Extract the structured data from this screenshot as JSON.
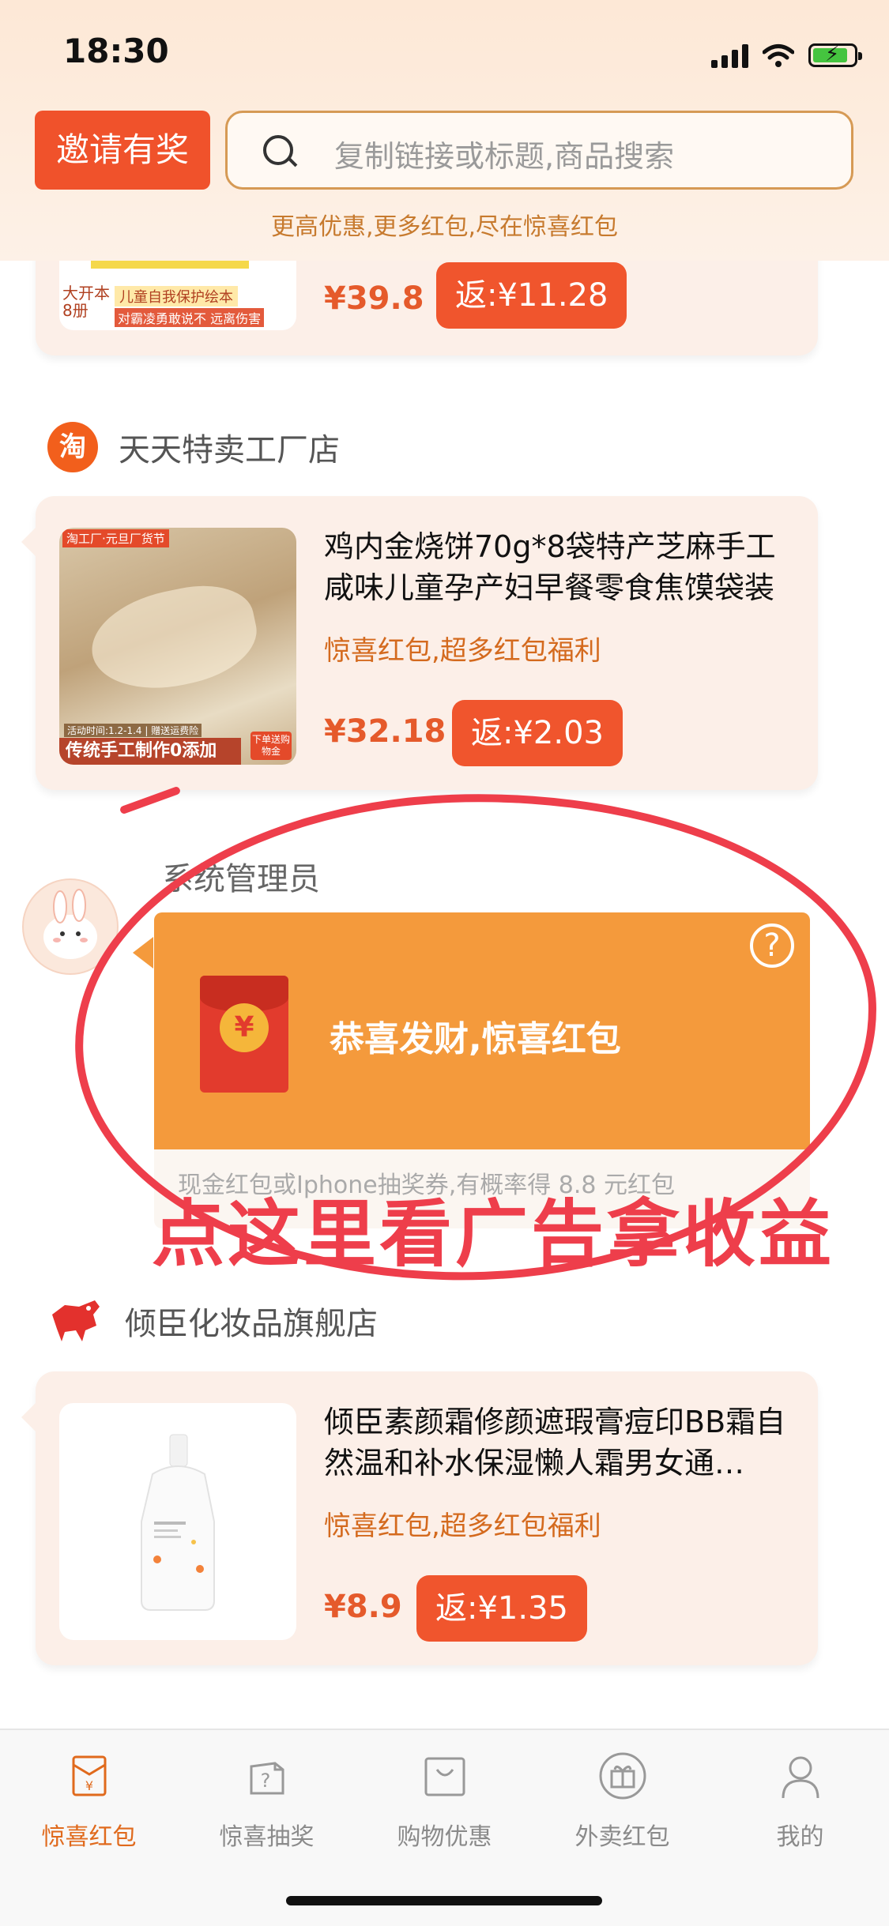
{
  "status_bar": {
    "time": "18:30"
  },
  "header": {
    "invite_label": "邀请有奖",
    "search_placeholder": "复制链接或标题,商品搜索",
    "slogan": "更高优惠,更多红包,尽在惊喜红包"
  },
  "cards": {
    "partial": {
      "price": "¥39.8",
      "rebate": "返:¥11.28",
      "image_text_1": "大开本8册",
      "image_text_2": "儿童自我保护绘本",
      "image_text_3": "对霸凌勇敢说不 远离伤害"
    },
    "item1": {
      "shop_name": "天天特卖工厂店",
      "shop_icon_text": "淘",
      "title": "鸡内金烧饼70g*8袋特产芝麻手工咸味儿童孕产妇早餐零食焦馍袋装",
      "subtitle": "惊喜红包,超多红包福利",
      "price": "¥32.18",
      "rebate": "返:¥2.03",
      "image_top_text": "淘工厂·元旦厂货节",
      "image_bottom_text": "传统手工制作0添加",
      "image_small_text": "活动时间:1.2-1.4 | 赠送运费险",
      "image_badge_text": "下单送购物金"
    },
    "admin": {
      "name": "系统管理员",
      "redpacket_title": "恭喜发财,惊喜红包",
      "redpacket_desc": "现金红包或Iphone抽奖券,有概率得 8.8 元红包",
      "coin_symbol": "¥",
      "help_symbol": "?"
    },
    "annotation": {
      "text": "点这里看广告拿收益"
    },
    "item2": {
      "shop_name": "倾臣化妆品旗舰店",
      "title": "倾臣素颜霜修颜遮瑕膏痘印BB霜自然温和补水保湿懒人霜男女通…",
      "subtitle": "惊喜红包,超多红包福利",
      "price": "¥8.9",
      "rebate": "返:¥1.35"
    }
  },
  "tabbar": {
    "tabs": [
      {
        "label": "惊喜红包",
        "icon": "red-packet-icon",
        "active": true
      },
      {
        "label": "惊喜抽奖",
        "icon": "lottery-box-icon",
        "active": false
      },
      {
        "label": "购物优惠",
        "icon": "shopping-bag-icon",
        "active": false
      },
      {
        "label": "外卖红包",
        "icon": "gift-icon",
        "active": false
      },
      {
        "label": "我的",
        "icon": "user-icon",
        "active": false
      }
    ]
  },
  "colors": {
    "accent": "#f0522b",
    "orange_card": "#f49a3c",
    "annotation_red": "#ee3e4b",
    "active_tab": "#e06a1d"
  }
}
